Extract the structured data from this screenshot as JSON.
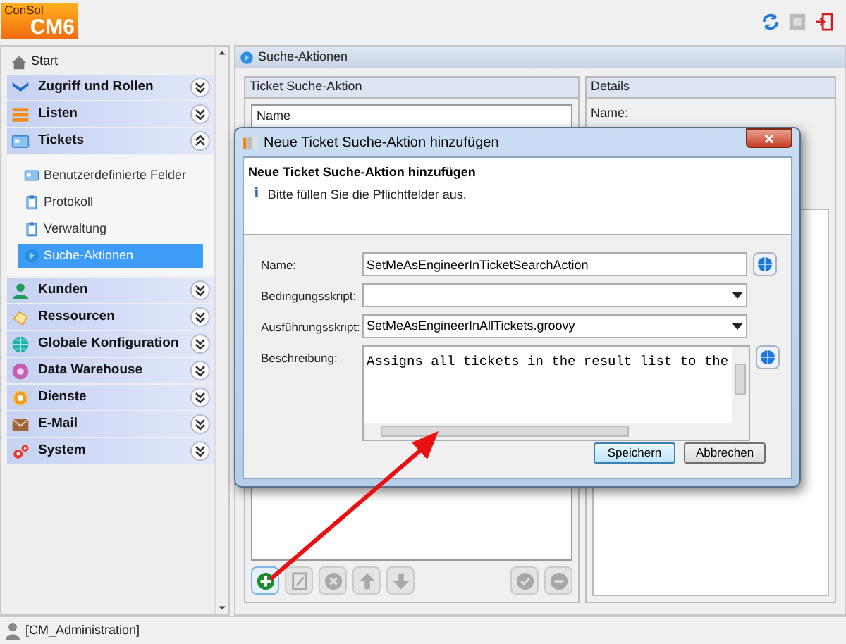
{
  "logo": {
    "brand": "ConSol",
    "product": "CM6"
  },
  "sidebar": {
    "start": "Start",
    "sections": [
      {
        "label": "Zugriff und Rollen",
        "kind": "chevrons",
        "expanded": false
      },
      {
        "label": "Listen",
        "kind": "list",
        "expanded": false
      },
      {
        "label": "Tickets",
        "kind": "card",
        "expanded": true,
        "children": [
          {
            "label": "Benutzerdefinierte Felder",
            "kind": "card",
            "selected": false
          },
          {
            "label": "Protokoll",
            "kind": "clipboard",
            "selected": false
          },
          {
            "label": "Verwaltung",
            "kind": "clipboard",
            "selected": false
          },
          {
            "label": "Suche-Aktionen",
            "kind": "play",
            "selected": true
          }
        ]
      },
      {
        "label": "Kunden",
        "kind": "person",
        "expanded": false
      },
      {
        "label": "Ressourcen",
        "kind": "resource",
        "expanded": false
      },
      {
        "label": "Globale Konfiguration",
        "kind": "globe",
        "expanded": false
      },
      {
        "label": "Data Warehouse",
        "kind": "warehouse",
        "expanded": false
      },
      {
        "label": "Dienste",
        "kind": "gear",
        "expanded": false
      },
      {
        "label": "E-Mail",
        "kind": "mail",
        "expanded": false
      },
      {
        "label": "System",
        "kind": "gears",
        "expanded": false
      }
    ]
  },
  "main": {
    "title": "Suche-Aktionen",
    "list_panel": {
      "title": "Ticket Suche-Aktion",
      "column": "Name",
      "toolbar": [
        {
          "kind": "add",
          "disabled": false
        },
        {
          "kind": "edit",
          "disabled": true
        },
        {
          "kind": "delete",
          "disabled": true
        },
        {
          "kind": "up",
          "disabled": true
        },
        {
          "kind": "down",
          "disabled": true
        },
        {
          "kind": "gap"
        },
        {
          "kind": "check",
          "disabled": true
        },
        {
          "kind": "minus",
          "disabled": true
        }
      ]
    },
    "details_panel": {
      "title": "Details",
      "name_label": "Name:"
    }
  },
  "dialog": {
    "title": "Neue Ticket Suche-Aktion hinzufügen",
    "heading": "Neue Ticket Suche-Aktion hinzufügen",
    "info_icon": "i",
    "hint": "Bitte füllen Sie die Pflichtfelder aus.",
    "fields": [
      {
        "kind": "text",
        "label": "Name:",
        "value": "SetMeAsEngineerInTicketSearchAction",
        "globe": true
      },
      {
        "kind": "select",
        "label": "Bedingungsskript:"
      },
      {
        "kind": "select",
        "label": "Ausführungsskript:",
        "value": "SetMeAsEngineerInAllTickets.groovy"
      },
      {
        "kind": "textarea",
        "label": "Beschreibung:",
        "value": "Assigns all tickets in the result list to the",
        "globe": true
      }
    ],
    "buttons": [
      {
        "label": "Speichern",
        "default": true
      },
      {
        "label": "Abbrechen",
        "default": false
      }
    ]
  },
  "status_bar": {
    "user": "[CM_Administration]"
  }
}
